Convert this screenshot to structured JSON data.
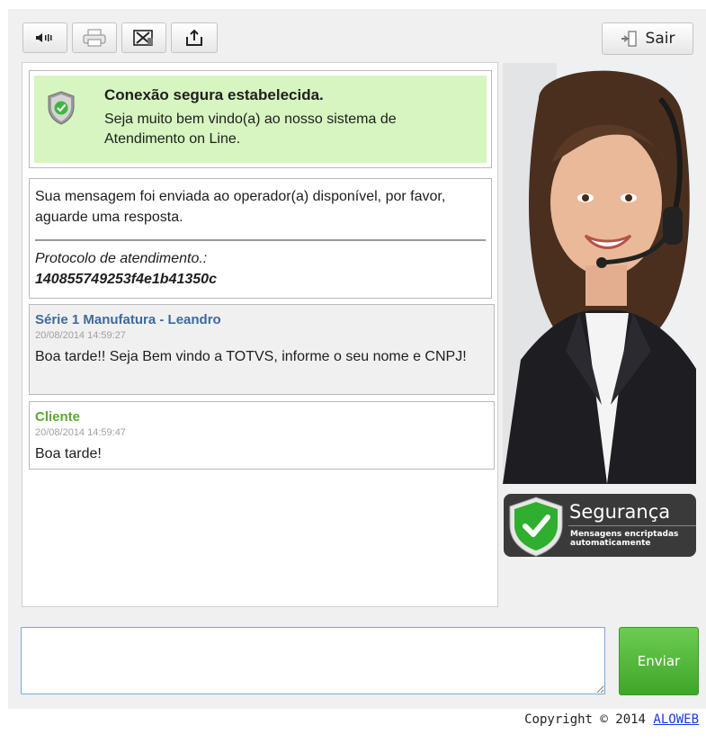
{
  "toolbar": {
    "buttons": [
      {
        "name": "sound-button",
        "icon": "speaker-icon"
      },
      {
        "name": "print-button",
        "icon": "printer-icon"
      },
      {
        "name": "clear-button",
        "icon": "clear-icon"
      },
      {
        "name": "export-button",
        "icon": "export-icon"
      }
    ],
    "exit_label": "Sair",
    "exit_icon": "exit-icon"
  },
  "secure_notice": {
    "title": "Conexão segura estabelecida.",
    "text": "Seja muito bem vindo(a) ao nosso sistema de Atendimento on Line.",
    "icon": "shield-check-icon"
  },
  "system_message": {
    "text": "Sua mensagem foi enviada ao operador(a) disponível, por favor, aguarde uma resposta.",
    "protocol_label": "Protocolo de atendimento.:",
    "protocol_code": "140855749253f4e1b41350c"
  },
  "messages": [
    {
      "author": "Série 1 Manufatura - Leandro",
      "timestamp": "20/08/2014 14:59:27",
      "text": "Boa tarde!! Seja Bem vindo a TOTVS, informe o seu nome e CNPJ!",
      "author_color": "#3d6a9e"
    },
    {
      "author": "Cliente",
      "timestamp": "20/08/2014 14:59:47",
      "text": "Boa tarde!",
      "author_color": "#5aa832"
    }
  ],
  "security_badge": {
    "title": "Segurança",
    "subtitle": "Mensagens encriptadas automaticamente",
    "icon": "shield-check-icon"
  },
  "composer": {
    "input_value": "",
    "send_label": "Enviar"
  },
  "footer": {
    "copyright_text": "Copyright © 2014",
    "link_text": "ALOWEB"
  },
  "colors": {
    "secure_bg": "#d6f5c0",
    "send_button": "#4fb836",
    "link": "#1a39e0"
  }
}
